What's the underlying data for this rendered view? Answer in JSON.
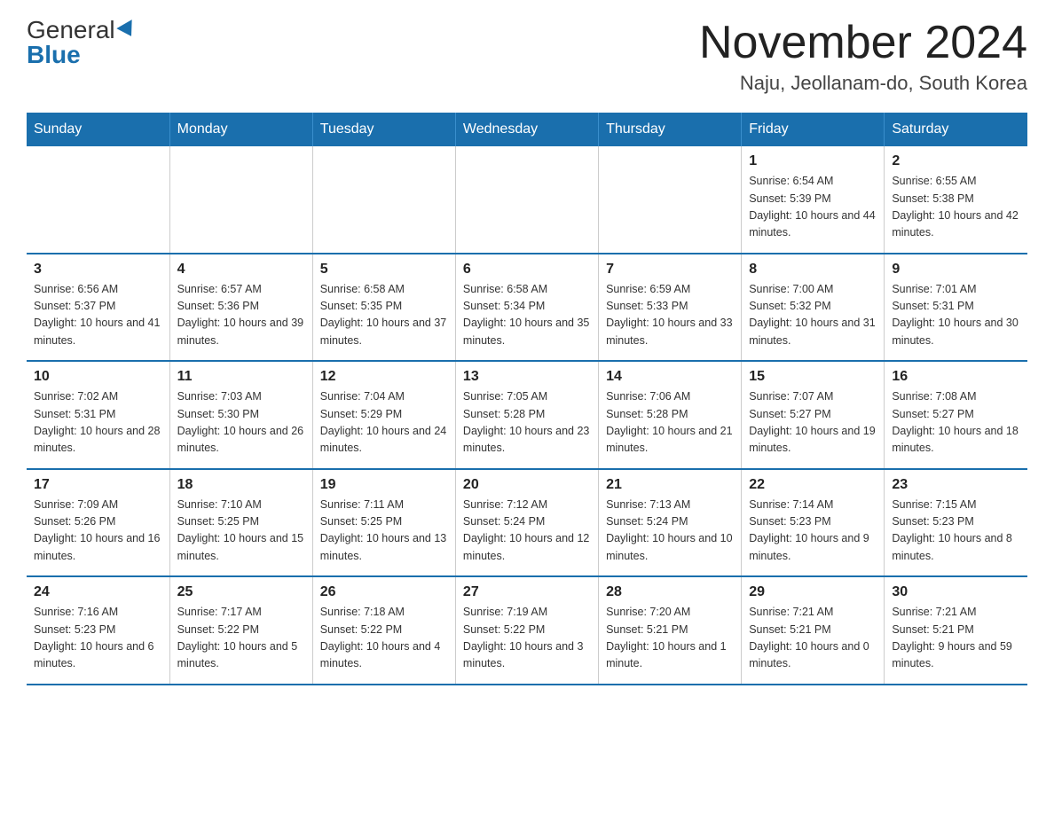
{
  "logo": {
    "general": "General",
    "blue": "Blue",
    "triangle": "▶"
  },
  "header": {
    "month": "November 2024",
    "location": "Naju, Jeollanam-do, South Korea"
  },
  "weekdays": [
    "Sunday",
    "Monday",
    "Tuesday",
    "Wednesday",
    "Thursday",
    "Friday",
    "Saturday"
  ],
  "weeks": [
    [
      {
        "day": "",
        "info": ""
      },
      {
        "day": "",
        "info": ""
      },
      {
        "day": "",
        "info": ""
      },
      {
        "day": "",
        "info": ""
      },
      {
        "day": "",
        "info": ""
      },
      {
        "day": "1",
        "info": "Sunrise: 6:54 AM\nSunset: 5:39 PM\nDaylight: 10 hours and 44 minutes."
      },
      {
        "day": "2",
        "info": "Sunrise: 6:55 AM\nSunset: 5:38 PM\nDaylight: 10 hours and 42 minutes."
      }
    ],
    [
      {
        "day": "3",
        "info": "Sunrise: 6:56 AM\nSunset: 5:37 PM\nDaylight: 10 hours and 41 minutes."
      },
      {
        "day": "4",
        "info": "Sunrise: 6:57 AM\nSunset: 5:36 PM\nDaylight: 10 hours and 39 minutes."
      },
      {
        "day": "5",
        "info": "Sunrise: 6:58 AM\nSunset: 5:35 PM\nDaylight: 10 hours and 37 minutes."
      },
      {
        "day": "6",
        "info": "Sunrise: 6:58 AM\nSunset: 5:34 PM\nDaylight: 10 hours and 35 minutes."
      },
      {
        "day": "7",
        "info": "Sunrise: 6:59 AM\nSunset: 5:33 PM\nDaylight: 10 hours and 33 minutes."
      },
      {
        "day": "8",
        "info": "Sunrise: 7:00 AM\nSunset: 5:32 PM\nDaylight: 10 hours and 31 minutes."
      },
      {
        "day": "9",
        "info": "Sunrise: 7:01 AM\nSunset: 5:31 PM\nDaylight: 10 hours and 30 minutes."
      }
    ],
    [
      {
        "day": "10",
        "info": "Sunrise: 7:02 AM\nSunset: 5:31 PM\nDaylight: 10 hours and 28 minutes."
      },
      {
        "day": "11",
        "info": "Sunrise: 7:03 AM\nSunset: 5:30 PM\nDaylight: 10 hours and 26 minutes."
      },
      {
        "day": "12",
        "info": "Sunrise: 7:04 AM\nSunset: 5:29 PM\nDaylight: 10 hours and 24 minutes."
      },
      {
        "day": "13",
        "info": "Sunrise: 7:05 AM\nSunset: 5:28 PM\nDaylight: 10 hours and 23 minutes."
      },
      {
        "day": "14",
        "info": "Sunrise: 7:06 AM\nSunset: 5:28 PM\nDaylight: 10 hours and 21 minutes."
      },
      {
        "day": "15",
        "info": "Sunrise: 7:07 AM\nSunset: 5:27 PM\nDaylight: 10 hours and 19 minutes."
      },
      {
        "day": "16",
        "info": "Sunrise: 7:08 AM\nSunset: 5:27 PM\nDaylight: 10 hours and 18 minutes."
      }
    ],
    [
      {
        "day": "17",
        "info": "Sunrise: 7:09 AM\nSunset: 5:26 PM\nDaylight: 10 hours and 16 minutes."
      },
      {
        "day": "18",
        "info": "Sunrise: 7:10 AM\nSunset: 5:25 PM\nDaylight: 10 hours and 15 minutes."
      },
      {
        "day": "19",
        "info": "Sunrise: 7:11 AM\nSunset: 5:25 PM\nDaylight: 10 hours and 13 minutes."
      },
      {
        "day": "20",
        "info": "Sunrise: 7:12 AM\nSunset: 5:24 PM\nDaylight: 10 hours and 12 minutes."
      },
      {
        "day": "21",
        "info": "Sunrise: 7:13 AM\nSunset: 5:24 PM\nDaylight: 10 hours and 10 minutes."
      },
      {
        "day": "22",
        "info": "Sunrise: 7:14 AM\nSunset: 5:23 PM\nDaylight: 10 hours and 9 minutes."
      },
      {
        "day": "23",
        "info": "Sunrise: 7:15 AM\nSunset: 5:23 PM\nDaylight: 10 hours and 8 minutes."
      }
    ],
    [
      {
        "day": "24",
        "info": "Sunrise: 7:16 AM\nSunset: 5:23 PM\nDaylight: 10 hours and 6 minutes."
      },
      {
        "day": "25",
        "info": "Sunrise: 7:17 AM\nSunset: 5:22 PM\nDaylight: 10 hours and 5 minutes."
      },
      {
        "day": "26",
        "info": "Sunrise: 7:18 AM\nSunset: 5:22 PM\nDaylight: 10 hours and 4 minutes."
      },
      {
        "day": "27",
        "info": "Sunrise: 7:19 AM\nSunset: 5:22 PM\nDaylight: 10 hours and 3 minutes."
      },
      {
        "day": "28",
        "info": "Sunrise: 7:20 AM\nSunset: 5:21 PM\nDaylight: 10 hours and 1 minute."
      },
      {
        "day": "29",
        "info": "Sunrise: 7:21 AM\nSunset: 5:21 PM\nDaylight: 10 hours and 0 minutes."
      },
      {
        "day": "30",
        "info": "Sunrise: 7:21 AM\nSunset: 5:21 PM\nDaylight: 9 hours and 59 minutes."
      }
    ]
  ]
}
